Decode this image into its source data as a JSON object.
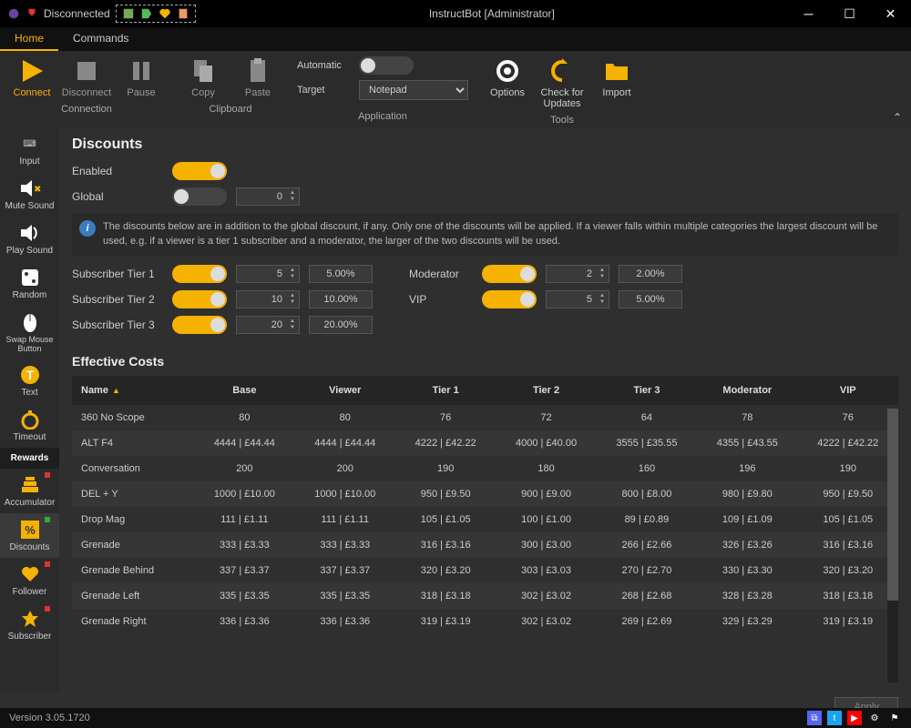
{
  "window": {
    "title": "InstructBot [Administrator]",
    "status": "Disconnected"
  },
  "tabs": {
    "home": "Home",
    "commands": "Commands"
  },
  "ribbon": {
    "connect": "Connect",
    "disconnect": "Disconnect",
    "pause": "Pause",
    "copy": "Copy",
    "paste": "Paste",
    "automatic": "Automatic",
    "target": "Target",
    "target_value": "Notepad",
    "options": "Options",
    "check": "Check for Updates",
    "import": "Import",
    "g_conn": "Connection",
    "g_clip": "Clipboard",
    "g_app": "Application",
    "g_tools": "Tools"
  },
  "sidebar": {
    "input": "Input",
    "mute": "Mute Sound",
    "play": "Play Sound",
    "random": "Random",
    "swap": "Swap Mouse Button",
    "text": "Text",
    "timeout": "Timeout",
    "rewards": "Rewards",
    "accum": "Accumulator",
    "discounts": "Discounts",
    "follower": "Follower",
    "subscriber": "Subscriber"
  },
  "page": {
    "title": "Discounts",
    "enabled": "Enabled",
    "global": "Global",
    "global_val": "0",
    "info": "The discounts below are in addition to the global discount, if any. Only one of the discounts will be applied. If a viewer falls within multiple categories the largest discount will be used, e.g. if a viewer is a tier 1 subscriber and a moderator, the larger of the two discounts will be used.",
    "tiers": {
      "t1": {
        "label": "Subscriber Tier 1",
        "val": "5",
        "pct": "5.00%"
      },
      "t2": {
        "label": "Subscriber Tier 2",
        "val": "10",
        "pct": "10.00%"
      },
      "t3": {
        "label": "Subscriber Tier 3",
        "val": "20",
        "pct": "20.00%"
      },
      "mod": {
        "label": "Moderator",
        "val": "2",
        "pct": "2.00%"
      },
      "vip": {
        "label": "VIP",
        "val": "5",
        "pct": "5.00%"
      }
    },
    "costs_title": "Effective Costs",
    "cols": {
      "name": "Name",
      "base": "Base",
      "viewer": "Viewer",
      "t1": "Tier 1",
      "t2": "Tier 2",
      "t3": "Tier 3",
      "mod": "Moderator",
      "vip": "VIP"
    },
    "rows": [
      {
        "n": "360 No Scope",
        "b": "80",
        "v": "80",
        "t1": "76",
        "t2": "72",
        "t3": "64",
        "m": "78",
        "p": "76"
      },
      {
        "n": "ALT F4",
        "b": "4444 | £44.44",
        "v": "4444 | £44.44",
        "t1": "4222 | £42.22",
        "t2": "4000 | £40.00",
        "t3": "3555 | £35.55",
        "m": "4355 | £43.55",
        "p": "4222 | £42.22"
      },
      {
        "n": "Conversation",
        "b": "200",
        "v": "200",
        "t1": "190",
        "t2": "180",
        "t3": "160",
        "m": "196",
        "p": "190"
      },
      {
        "n": "DEL + Y",
        "b": "1000 | £10.00",
        "v": "1000 | £10.00",
        "t1": "950 | £9.50",
        "t2": "900 | £9.00",
        "t3": "800 | £8.00",
        "m": "980 | £9.80",
        "p": "950 | £9.50"
      },
      {
        "n": "Drop Mag",
        "b": "111 | £1.11",
        "v": "111 | £1.11",
        "t1": "105 | £1.05",
        "t2": "100 | £1.00",
        "t3": "89 | £0.89",
        "m": "109 | £1.09",
        "p": "105 | £1.05"
      },
      {
        "n": "Grenade",
        "b": "333 | £3.33",
        "v": "333 | £3.33",
        "t1": "316 | £3.16",
        "t2": "300 | £3.00",
        "t3": "266 | £2.66",
        "m": "326 | £3.26",
        "p": "316 | £3.16"
      },
      {
        "n": "Grenade Behind",
        "b": "337 | £3.37",
        "v": "337 | £3.37",
        "t1": "320 | £3.20",
        "t2": "303 | £3.03",
        "t3": "270 | £2.70",
        "m": "330 | £3.30",
        "p": "320 | £3.20"
      },
      {
        "n": "Grenade Left",
        "b": "335 | £3.35",
        "v": "335 | £3.35",
        "t1": "318 | £3.18",
        "t2": "302 | £3.02",
        "t3": "268 | £2.68",
        "m": "328 | £3.28",
        "p": "318 | £3.18"
      },
      {
        "n": "Grenade Right",
        "b": "336 | £3.36",
        "v": "336 | £3.36",
        "t1": "319 | £3.19",
        "t2": "302 | £3.02",
        "t3": "269 | £2.69",
        "m": "329 | £3.29",
        "p": "319 | £3.19"
      }
    ],
    "apply": "Apply"
  },
  "footer": {
    "version": "Version 3.05.1720"
  }
}
